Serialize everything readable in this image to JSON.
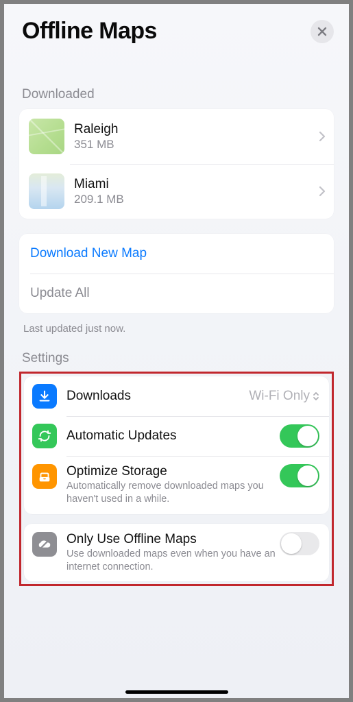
{
  "header": {
    "title": "Offline Maps"
  },
  "sections": {
    "downloaded_label": "Downloaded",
    "settings_label": "Settings"
  },
  "maps": [
    {
      "name": "Raleigh",
      "size": "351 MB"
    },
    {
      "name": "Miami",
      "size": "209.1 MB"
    }
  ],
  "actions": {
    "download_new": "Download New Map",
    "update_all": "Update All",
    "last_updated": "Last updated just now."
  },
  "settings": {
    "downloads": {
      "label": "Downloads",
      "value": "Wi-Fi Only"
    },
    "auto_updates": {
      "label": "Automatic Updates",
      "on": true
    },
    "optimize": {
      "label": "Optimize Storage",
      "desc": "Automatically remove downloaded maps you haven't used in a while.",
      "on": true
    },
    "offline_only": {
      "label": "Only Use Offline Maps",
      "desc": "Use downloaded maps even when you have an internet connection.",
      "on": false
    }
  }
}
